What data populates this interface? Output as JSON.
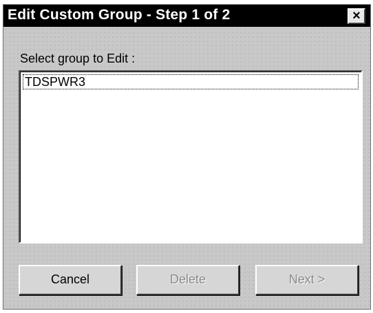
{
  "dialog": {
    "title": "Edit Custom Group - Step 1 of 2",
    "close_glyph": "×"
  },
  "prompt_label": "Select group to Edit :",
  "groups": [
    {
      "label": "TDSPWR3"
    }
  ],
  "buttons": {
    "cancel_label": "Cancel",
    "delete_label": "Delete",
    "next_label": "Next >"
  }
}
